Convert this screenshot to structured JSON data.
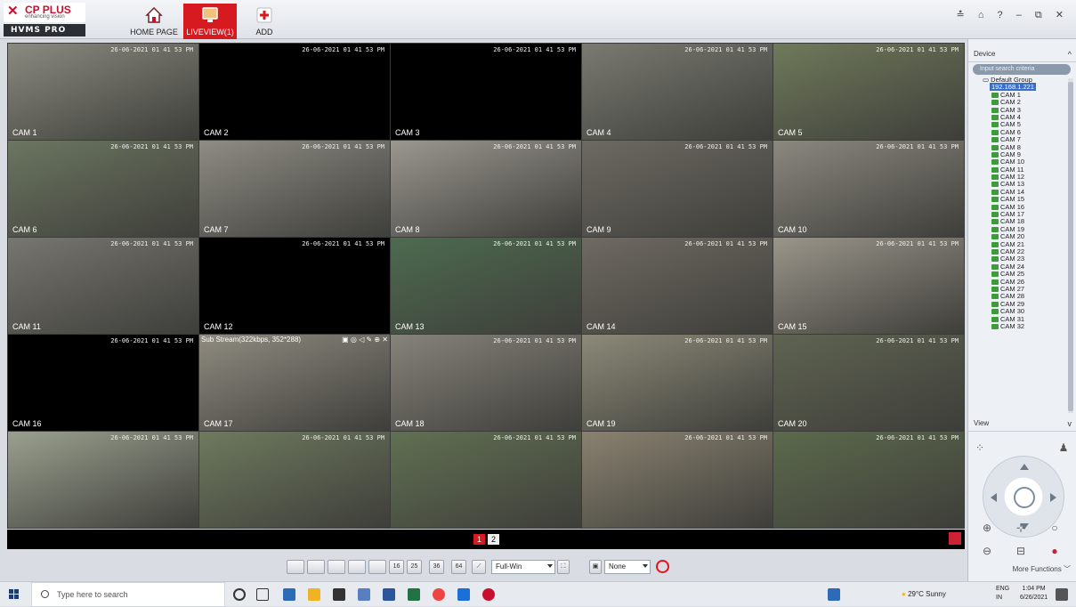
{
  "app": {
    "brand": "CP PLUS",
    "tagline": "enhancing vision",
    "product": "HVMS PRO"
  },
  "nav": [
    {
      "label": "HOME PAGE",
      "icon": "home-icon",
      "active": false
    },
    {
      "label": "LIVEVIEW(1)",
      "icon": "monitor-icon",
      "active": true
    },
    {
      "label": "ADD",
      "icon": "plus-icon",
      "active": false
    }
  ],
  "window_controls": "≛ ⌂ ? – ⧉ ✕",
  "timestamp": "26-06-2021 01 41 53 PM",
  "grid": {
    "columns": 5,
    "rows": 5,
    "cells": [
      {
        "cam": "CAM 1",
        "feed": "indoor",
        "color": "#8a8a80"
      },
      {
        "cam": "CAM 2",
        "feed": "black",
        "color": "#000000"
      },
      {
        "cam": "CAM 3",
        "feed": "black",
        "color": "#000000"
      },
      {
        "cam": "CAM 4",
        "feed": "indoor",
        "color": "#7a7a72"
      },
      {
        "cam": "CAM 5",
        "feed": "outdoor",
        "color": "#6f7a5a"
      },
      {
        "cam": "CAM 6",
        "feed": "outdoor",
        "color": "#6b7660"
      },
      {
        "cam": "CAM 7",
        "feed": "corridor",
        "color": "#8e8c84"
      },
      {
        "cam": "CAM 8",
        "feed": "corridor",
        "color": "#9a978f"
      },
      {
        "cam": "CAM 9",
        "feed": "indoor",
        "color": "#6d6a62"
      },
      {
        "cam": "CAM 10",
        "feed": "indoor",
        "color": "#8b887f"
      },
      {
        "cam": "CAM 11",
        "feed": "indoor",
        "color": "#777670"
      },
      {
        "cam": "CAM 12",
        "feed": "black",
        "color": "#000000"
      },
      {
        "cam": "CAM 13",
        "feed": "hall",
        "color": "#4d6b4f"
      },
      {
        "cam": "CAM 14",
        "feed": "outdoor",
        "color": "#6f6a62"
      },
      {
        "cam": "CAM 15",
        "feed": "corridor",
        "color": "#9a958a"
      },
      {
        "cam": "CAM 16",
        "feed": "black",
        "color": "#000000"
      },
      {
        "cam": "CAM 17",
        "feed": "corridor",
        "color": "#8f8b80",
        "sub": "Sub Stream(322kbps, 352*288)"
      },
      {
        "cam": "CAM 18",
        "feed": "corridor",
        "color": "#86837a"
      },
      {
        "cam": "CAM 19",
        "feed": "outdoor",
        "color": "#8c8a78"
      },
      {
        "cam": "CAM 20",
        "feed": "outdoor",
        "color": "#5f6451"
      },
      {
        "cam": "",
        "feed": "outdoor",
        "color": "#9aa08e"
      },
      {
        "cam": "",
        "feed": "outdoor",
        "color": "#6e7a5e"
      },
      {
        "cam": "",
        "feed": "outdoor",
        "color": "#617052"
      },
      {
        "cam": "",
        "feed": "corridor",
        "color": "#8a8270"
      },
      {
        "cam": "",
        "feed": "outdoor",
        "color": "#5c6a4c"
      }
    ]
  },
  "pager": {
    "pages": [
      "1",
      "2"
    ],
    "active": "1"
  },
  "toolbar": {
    "layout_buttons": [
      "",
      "",
      "",
      "",
      "",
      "16",
      "25",
      "36",
      "64"
    ],
    "fullwin": "Full-Win",
    "stream": "None"
  },
  "panel": {
    "device_title": "Device",
    "search_placeholder": "Input search criteria",
    "group": "Default Group",
    "device": "192.168.1.221",
    "cameras": [
      "CAM 1",
      "CAM 2",
      "CAM 3",
      "CAM 4",
      "CAM 5",
      "CAM 6",
      "CAM 7",
      "CAM 8",
      "CAM 9",
      "CAM 10",
      "CAM 11",
      "CAM 12",
      "CAM 13",
      "CAM 14",
      "CAM 15",
      "CAM 16",
      "CAM 17",
      "CAM 18",
      "CAM 19",
      "CAM 20",
      "CAM 21",
      "CAM 22",
      "CAM 23",
      "CAM 24",
      "CAM 25",
      "CAM 26",
      "CAM 27",
      "CAM 28",
      "CAM 29",
      "CAM 30",
      "CAM 31",
      "CAM 32"
    ],
    "view_title": "View",
    "more_functions": "More Functions"
  },
  "taskbar": {
    "search_placeholder": "Type here to search",
    "weather": "29°C  Sunny",
    "lang": "ENG",
    "region": "IN",
    "time": "1:04 PM",
    "date": "6/26/2021"
  },
  "colors": {
    "accent": "#d71920",
    "panel": "#edf0f4",
    "highlight": "#3a6fc9"
  }
}
